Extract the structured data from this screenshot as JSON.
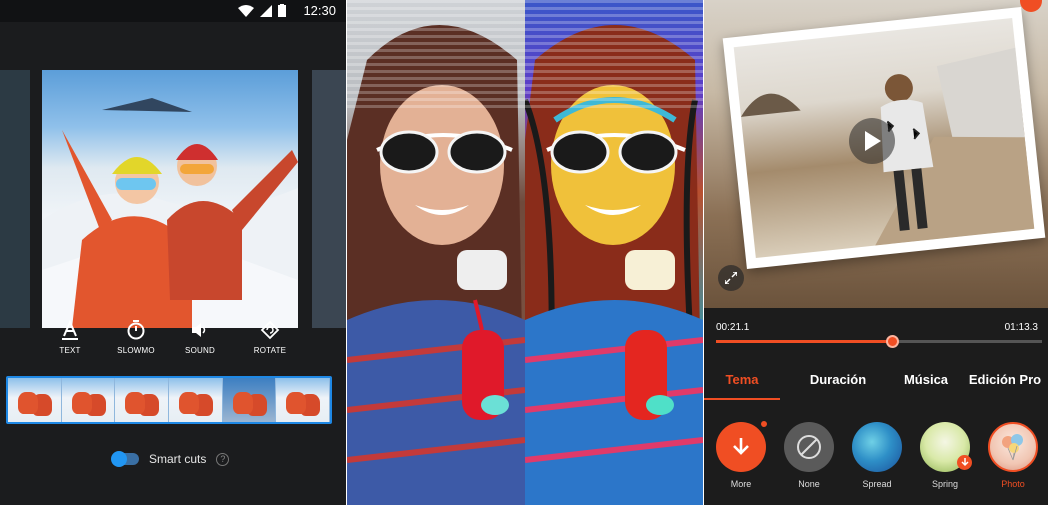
{
  "status_bar": {
    "time": "12:30"
  },
  "editor": {
    "tools": [
      {
        "label": "TEXT",
        "icon": "text-icon"
      },
      {
        "label": "SLOWMO",
        "icon": "timer-icon"
      },
      {
        "label": "SOUND",
        "icon": "speaker-icon"
      },
      {
        "label": "ROTATE",
        "icon": "rotate-icon"
      }
    ],
    "smart_cuts_label": "Smart cuts",
    "help_glyph": "?"
  },
  "player": {
    "current_time": "00:21.1",
    "total_time": "01:13.3",
    "progress": 0.54
  },
  "tabs": [
    {
      "label": "Tema",
      "active": true
    },
    {
      "label": "Duración",
      "active": false
    },
    {
      "label": "Música",
      "active": false
    },
    {
      "label": "Edición Pro",
      "active": false
    }
  ],
  "themes": [
    {
      "label": "More",
      "icon": "download-icon"
    },
    {
      "label": "None",
      "icon": "none-icon"
    },
    {
      "label": "Spread",
      "icon": ""
    },
    {
      "label": "Spring",
      "icon": "download-badge-icon"
    },
    {
      "label": "Photo",
      "icon": "",
      "active": true
    }
  ],
  "colors": {
    "accent": "#f04e23",
    "blue": "#1e88e5"
  }
}
